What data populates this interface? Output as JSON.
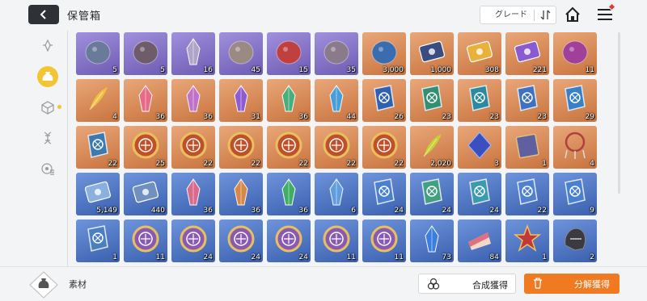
{
  "header": {
    "title": "保管箱",
    "sort_label": "グレード"
  },
  "sidebar": {
    "categories": [
      {
        "icon": "crystal-outline-icon",
        "active": false
      },
      {
        "icon": "material-bag-icon",
        "active": true
      },
      {
        "icon": "cube-outline-icon",
        "active": false
      },
      {
        "icon": "dna-icon",
        "active": false
      },
      {
        "icon": "disc-stack-icon",
        "active": false
      }
    ]
  },
  "colors": {
    "purple": "#8a76c9",
    "orange": "#d98c57",
    "blue": "#4a6fc0",
    "accent": "#ef7a21",
    "active": "#f2c533"
  },
  "rows": [
    [
      {
        "tier": "purple",
        "icon": "stone-head-icon",
        "count": "5",
        "color": "#6a7a9a"
      },
      {
        "tier": "purple",
        "icon": "rock-core-icon",
        "count": "5",
        "color": "#6e5c6a"
      },
      {
        "tier": "purple",
        "icon": "crystal-orb-icon",
        "count": "16",
        "color": "#b0a8c8"
      },
      {
        "tier": "purple",
        "icon": "skull-rock-icon",
        "count": "45",
        "color": "#9b8a84"
      },
      {
        "tier": "purple",
        "icon": "magma-rock-icon",
        "count": "15",
        "color": "#c04040"
      },
      {
        "tier": "purple",
        "icon": "shell-mask-icon",
        "count": "35",
        "color": "#8a7a8a"
      },
      {
        "tier": "orange",
        "icon": "blue-flower-core-icon",
        "count": "3,000",
        "color": "#3a6db0"
      },
      {
        "tier": "orange",
        "icon": "data-card-icon",
        "count": "1,000",
        "color": "#3a4c80"
      },
      {
        "tier": "orange",
        "icon": "gold-ticket-icon",
        "count": "308",
        "color": "#e8b23a"
      },
      {
        "tier": "orange",
        "icon": "star-ticket-icon",
        "count": "221",
        "color": "#8a5ad0"
      },
      {
        "tier": "orange",
        "icon": "purple-eye-orb-icon",
        "count": "11",
        "color": "#a0409a"
      }
    ],
    [
      {
        "tier": "orange",
        "icon": "gold-feather-icon",
        "count": "4",
        "color": "#f0c040"
      },
      {
        "tier": "orange",
        "icon": "pink-crystal-icon",
        "count": "36",
        "color": "#e86a8a"
      },
      {
        "tier": "orange",
        "icon": "violet-crystal-icon",
        "count": "36",
        "color": "#c070d0"
      },
      {
        "tier": "orange",
        "icon": "purple-crystal-icon",
        "count": "31",
        "color": "#8a5ad8"
      },
      {
        "tier": "orange",
        "icon": "green-crystal-icon",
        "count": "36",
        "color": "#40b080"
      },
      {
        "tier": "orange",
        "icon": "blue-crystal-icon",
        "count": "44",
        "color": "#40a0e0"
      },
      {
        "tier": "orange",
        "icon": "blue-book-icon",
        "count": "26",
        "color": "#3060b0"
      },
      {
        "tier": "orange",
        "icon": "green-shield-book-icon",
        "count": "23",
        "color": "#309070"
      },
      {
        "tier": "orange",
        "icon": "teal-eye-book-icon",
        "count": "23",
        "color": "#2a8aa0"
      },
      {
        "tier": "orange",
        "icon": "blue-sword-book-icon",
        "count": "23",
        "color": "#4070c0"
      },
      {
        "tier": "orange",
        "icon": "blue-cross-book-icon",
        "count": "29",
        "color": "#3a80c8"
      }
    ],
    [
      {
        "tier": "orange",
        "icon": "rune-book-icon",
        "count": "22",
        "color": "#3a7ab0"
      },
      {
        "tier": "orange",
        "icon": "sun-medal-icon",
        "count": "25",
        "color": "#c0502a"
      },
      {
        "tier": "orange",
        "icon": "sun-medal-icon",
        "count": "22",
        "color": "#c0502a"
      },
      {
        "tier": "orange",
        "icon": "sun-medal-icon",
        "count": "22",
        "color": "#c0502a"
      },
      {
        "tier": "orange",
        "icon": "sun-medal-icon",
        "count": "22",
        "color": "#c0502a"
      },
      {
        "tier": "orange",
        "icon": "sun-medal-icon",
        "count": "22",
        "color": "#c0502a"
      },
      {
        "tier": "orange",
        "icon": "sun-medal-icon",
        "count": "22",
        "color": "#c0502a"
      },
      {
        "tier": "orange",
        "icon": "green-sprout-icon",
        "count": "2,020",
        "color": "#c8d030"
      },
      {
        "tier": "orange",
        "icon": "blue-diamond-icon",
        "count": "3",
        "color": "#3a50c0"
      },
      {
        "tier": "orange",
        "icon": "tome-icon",
        "count": "1",
        "color": "#6060a0"
      },
      {
        "tier": "orange",
        "icon": "dreamcatcher-icon",
        "count": "4",
        "color": "#b04040"
      }
    ],
    [
      {
        "tier": "blue",
        "icon": "blue-ticket-icon",
        "count": "5,149",
        "color": "#8ab0e0"
      },
      {
        "tier": "blue",
        "icon": "card-ticket-icon",
        "count": "440",
        "color": "#7090c0"
      },
      {
        "tier": "blue",
        "icon": "pink-shard-icon",
        "count": "36",
        "color": "#e06a8a"
      },
      {
        "tier": "blue",
        "icon": "orange-shard-icon",
        "count": "36",
        "color": "#e08a40"
      },
      {
        "tier": "blue",
        "icon": "green-shard-icon",
        "count": "36",
        "color": "#40b060"
      },
      {
        "tier": "blue",
        "icon": "blue-shard-icon",
        "count": "6",
        "color": "#60a0e0"
      },
      {
        "tier": "blue",
        "icon": "blue-sword-book-icon",
        "count": "24",
        "color": "#4a80d0"
      },
      {
        "tier": "blue",
        "icon": "green-shield-book-icon",
        "count": "24",
        "color": "#40a080"
      },
      {
        "tier": "blue",
        "icon": "teal-eye-book-icon",
        "count": "24",
        "color": "#3a9ab0"
      },
      {
        "tier": "blue",
        "icon": "blue-sword-book-icon",
        "count": "22",
        "color": "#5080d0"
      },
      {
        "tier": "blue",
        "icon": "blue-cross-book-icon",
        "count": "9",
        "color": "#4a80d0"
      }
    ],
    [
      {
        "tier": "blue",
        "icon": "rune-book-icon",
        "count": "1",
        "color": "#4a80c0"
      },
      {
        "tier": "blue",
        "icon": "silver-medal-icon",
        "count": "11",
        "color": "#8a5ab0"
      },
      {
        "tier": "blue",
        "icon": "silver-medal-icon",
        "count": "24",
        "color": "#8a5ab0"
      },
      {
        "tier": "blue",
        "icon": "silver-medal-icon",
        "count": "24",
        "color": "#8a5ab0"
      },
      {
        "tier": "blue",
        "icon": "silver-medal-icon",
        "count": "24",
        "color": "#8a5ab0"
      },
      {
        "tier": "blue",
        "icon": "silver-medal-icon",
        "count": "11",
        "color": "#8a5ab0"
      },
      {
        "tier": "blue",
        "icon": "silver-medal-icon",
        "count": "11",
        "color": "#8a5ab0"
      },
      {
        "tier": "blue",
        "icon": "blue-feather-crystal-icon",
        "count": "73",
        "color": "#3a80e0"
      },
      {
        "tier": "blue",
        "icon": "cake-icon",
        "count": "84",
        "color": "#e07080"
      },
      {
        "tier": "blue",
        "icon": "red-star-badge-icon",
        "count": "1",
        "color": "#c03a3a"
      },
      {
        "tier": "blue",
        "icon": "dark-helmet-icon",
        "count": "2",
        "color": "#3a3a40"
      }
    ]
  ],
  "footer": {
    "label": "素材",
    "compose_label": "合成獲得",
    "dismantle_label": "分解獲得"
  }
}
